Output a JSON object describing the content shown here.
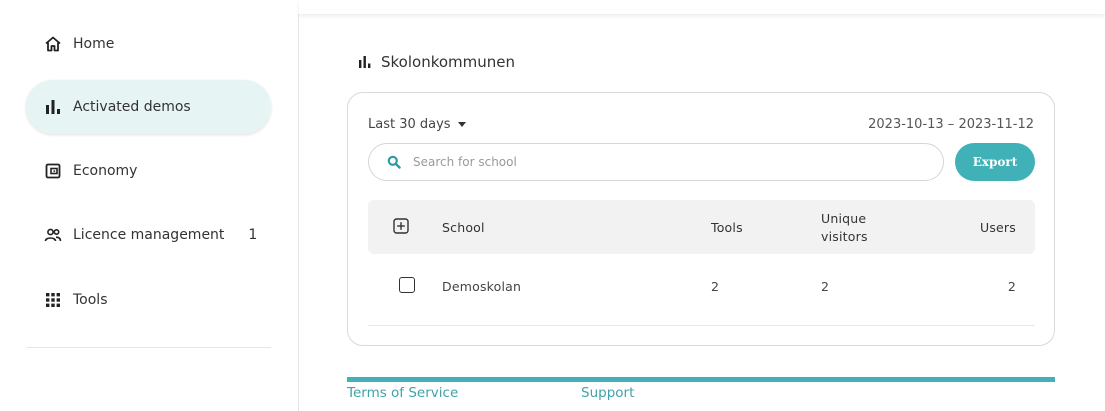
{
  "sidebar": {
    "items": [
      {
        "label": "Home",
        "icon": "home-icon"
      },
      {
        "label": "Activated demos",
        "icon": "bar-chart-icon"
      },
      {
        "label": "Economy",
        "icon": "wallet-icon"
      },
      {
        "label": "Licence management",
        "icon": "people-icon",
        "count": "1"
      },
      {
        "label": "Tools",
        "icon": "grid-icon"
      }
    ]
  },
  "main": {
    "title": "Skolonkommunen",
    "period": "Last 30 days",
    "date_range": "2023-10-13 – 2023-11-12",
    "search": {
      "placeholder": "Search for school",
      "value": ""
    },
    "export_label": "Export",
    "table": {
      "headers": {
        "school": "School",
        "tools": "Tools",
        "unique_visitors": "Unique visitors",
        "users": "Users"
      },
      "rows": [
        {
          "school": "Demoskolan",
          "tools": "2",
          "unique_visitors": "2",
          "users": "2"
        }
      ]
    }
  },
  "footer": {
    "terms": "Terms of Service",
    "support": "Support"
  },
  "colors": {
    "accent": "#41b1b8",
    "active_nav_bg": "#e7f4f4",
    "table_header_bg": "#f2f2f2"
  }
}
